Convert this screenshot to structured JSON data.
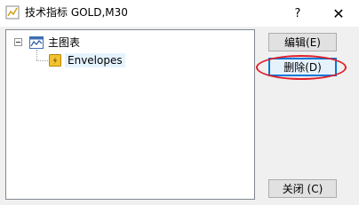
{
  "window": {
    "title": "技术指标 GOLD,M30",
    "help_label": "?",
    "close_label": "✕"
  },
  "tree": {
    "root": {
      "label": "主图表",
      "icon": "chart-window-icon"
    },
    "children": [
      {
        "label": "Envelopes",
        "icon": "custom-indicator-icon"
      }
    ]
  },
  "buttons": {
    "edit": "编辑(E)",
    "delete": "删除(D)",
    "close": "关闭 (C)"
  },
  "colors": {
    "annotation": "#e0202a",
    "indicator_icon": "#f2c230"
  }
}
